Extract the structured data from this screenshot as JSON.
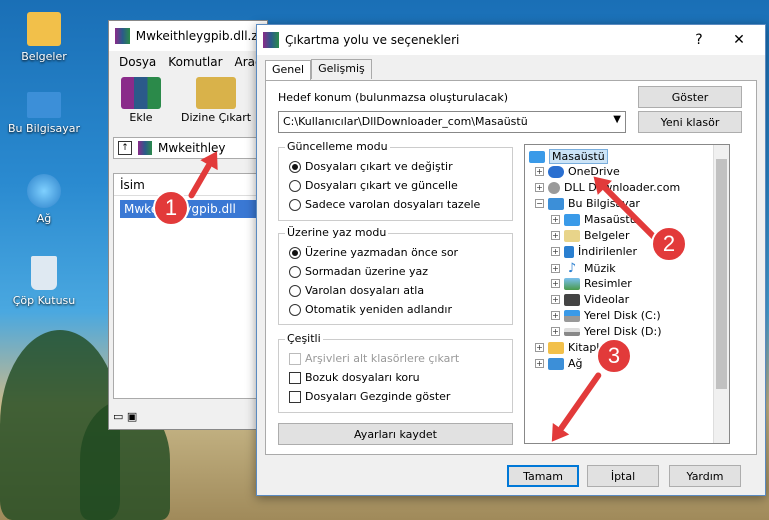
{
  "desktop": {
    "icons": [
      {
        "label": "Belgeler"
      },
      {
        "label": "Bu Bilgisayar"
      },
      {
        "label": "Ağ"
      },
      {
        "label": "Çöp Kutusu"
      }
    ]
  },
  "rar": {
    "title": "Mwkeithleygpib.dll.zi",
    "menu": [
      "Dosya",
      "Komutlar",
      "Araçla"
    ],
    "tools": [
      {
        "label": "Ekle"
      },
      {
        "label": "Dizine Çıkart"
      }
    ],
    "path": "Mwkeithley",
    "list_header": "İsim",
    "file": "Mwkeithleygpib.dll"
  },
  "dialog": {
    "title": "Çıkartma yolu ve seçenekleri",
    "help": "?",
    "close": "✕",
    "tabs": [
      "Genel",
      "Gelişmiş"
    ],
    "dest_label": "Hedef konum (bulunmazsa oluşturulacak)",
    "dest_value": "C:\\Kullanıcılar\\DllDownloader_com\\Masaüstü",
    "show_btn": "Göster",
    "new_folder_btn": "Yeni klasör",
    "update_mode": {
      "title": "Güncelleme modu",
      "options": [
        "Dosyaları çıkart ve değiştir",
        "Dosyaları çıkart ve güncelle",
        "Sadece varolan dosyaları tazele"
      ],
      "selected": 0
    },
    "overwrite_mode": {
      "title": "Üzerine yaz modu",
      "options": [
        "Üzerine yazmadan önce sor",
        "Sormadan üzerine yaz",
        "Varolan dosyaları atla",
        "Otomatik yeniden adlandır"
      ],
      "selected": 0
    },
    "misc": {
      "title": "Çeşitli",
      "options": [
        "Arşivleri alt klasörlere çıkart",
        "Bozuk dosyaları koru",
        "Dosyaları Gezginde göster"
      ]
    },
    "save_btn": "Ayarları kaydet",
    "tree": [
      "Masaüstü",
      "OneDrive",
      "DLL Downloader.com",
      "Bu Bilgisayar",
      "Masaüstü",
      "Belgeler",
      "İndirilenler",
      "Müzik",
      "Resimler",
      "Videolar",
      "Yerel Disk (C:)",
      "Yerel Disk (D:)",
      "Kitaplıklar",
      "Ağ"
    ],
    "ok_btn": "Tamam",
    "cancel_btn": "İptal",
    "help_btn": "Yardım"
  },
  "steps": [
    "1",
    "2",
    "3"
  ],
  "colors": {
    "accent": "#e23a3a",
    "selection": "#3a78d4"
  }
}
